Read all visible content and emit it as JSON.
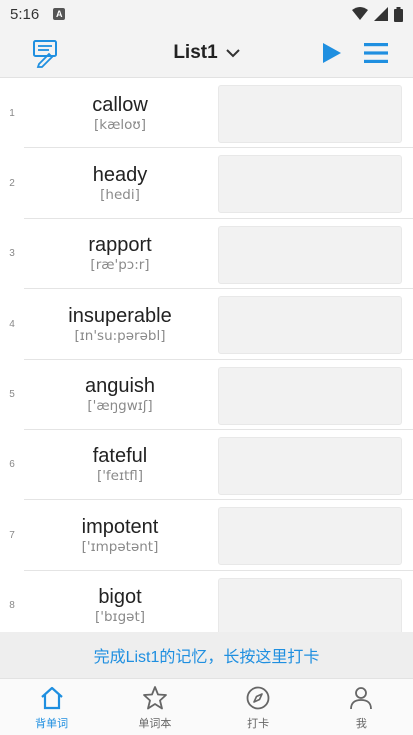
{
  "status": {
    "time": "5:16",
    "notif_glyph": "A"
  },
  "header": {
    "title": "List1"
  },
  "words": [
    {
      "num": "1",
      "word": "callow",
      "phonetic": "[kæloʊ]"
    },
    {
      "num": "2",
      "word": "heady",
      "phonetic": "[hedi]"
    },
    {
      "num": "3",
      "word": "rapport",
      "phonetic": "[ræ'pɔ:r]"
    },
    {
      "num": "4",
      "word": "insuperable",
      "phonetic": "[ɪn'su:pərəbl]"
    },
    {
      "num": "5",
      "word": "anguish",
      "phonetic": "['æŋgwɪʃ]"
    },
    {
      "num": "6",
      "word": "fateful",
      "phonetic": "['feɪtfl]"
    },
    {
      "num": "7",
      "word": "impotent",
      "phonetic": "['ɪmpətənt]"
    },
    {
      "num": "8",
      "word": "bigot",
      "phonetic": "['bɪgət]"
    }
  ],
  "hint": {
    "text": "完成List1的记忆，长按这里打卡"
  },
  "tabs": [
    {
      "label": "背单词",
      "icon": "home-icon",
      "active": true
    },
    {
      "label": "单词本",
      "icon": "star-icon",
      "active": false
    },
    {
      "label": "打卡",
      "icon": "compass-icon",
      "active": false
    },
    {
      "label": "我",
      "icon": "person-icon",
      "active": false
    }
  ],
  "colors": {
    "accent": "#1f8fe0",
    "header_bg": "#f3f3f3",
    "meaning_bg": "#f2f2f2"
  }
}
